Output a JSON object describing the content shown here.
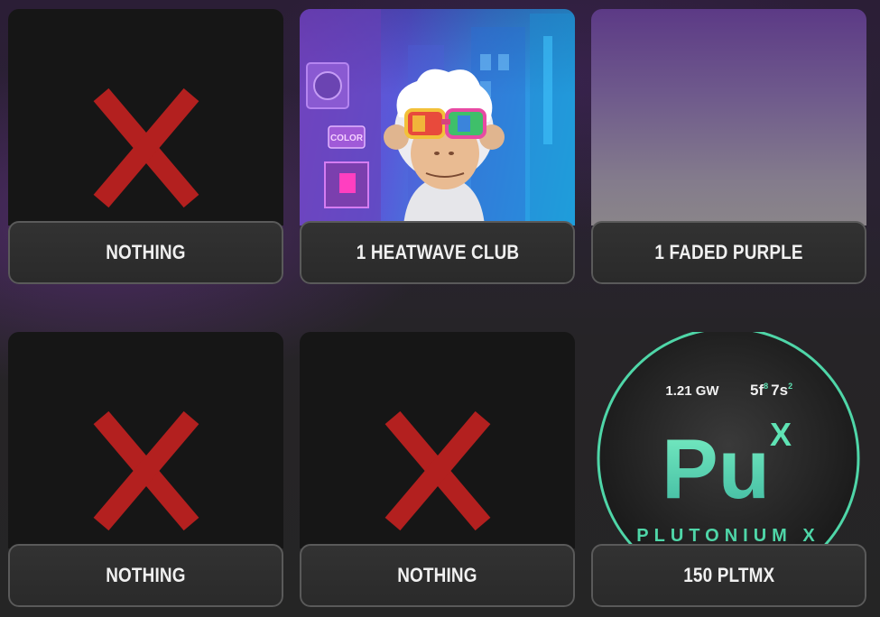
{
  "rewards": [
    {
      "label": "NOTHING",
      "icon": "red-x-icon"
    },
    {
      "label": "1 HEATWAVE CLUB",
      "icon": "ape-nft-image"
    },
    {
      "label": "1 FADED PURPLE",
      "icon": "faded-purple-swatch"
    },
    {
      "label": "NOTHING",
      "icon": "red-x-icon"
    },
    {
      "label": "NOTHING",
      "icon": "red-x-icon"
    },
    {
      "label": "150 PLTMX",
      "icon": "plutonium-coin"
    }
  ],
  "coin": {
    "left_text": "1.21 GW",
    "right_text": "5f",
    "right_sup1": "8",
    "right_text2": "7s",
    "right_sup2": "2",
    "symbol": "Pu",
    "symbol_sup": "X",
    "name": "PLUTONIUM X"
  },
  "heatwave_art": {
    "shop_sign": "COLOR"
  },
  "colors": {
    "x_mark": "#b3201f",
    "coin_ring": "#4fd6a8",
    "coin_text": "#5fe3b4"
  }
}
